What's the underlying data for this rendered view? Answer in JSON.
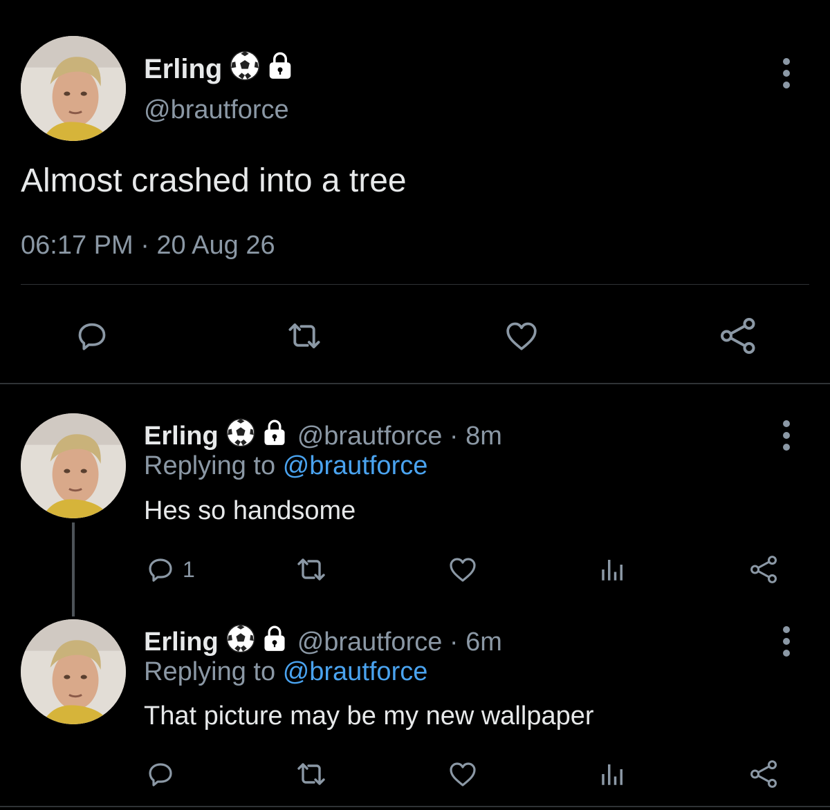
{
  "main_tweet": {
    "author_name": "Erling",
    "name_emoji": "⚽",
    "lock_icon": "lock-icon",
    "handle": "@brautforce",
    "text": "Almost crashed into a tree",
    "timestamp": "06:17 PM · 20 Aug 26",
    "actions": [
      "reply-icon",
      "retweet-icon",
      "like-icon",
      "share-icon"
    ]
  },
  "replies": [
    {
      "author_name": "Erling",
      "handle_time": "@brautforce · 8m",
      "replying_label": "Replying to",
      "replying_handle": "@brautforce",
      "text": "Hes so handsome",
      "reply_count": "1"
    },
    {
      "author_name": "Erling",
      "handle_time": "@brautforce · 6m",
      "replying_label": "Replying to",
      "replying_handle": "@brautforce",
      "text": "That picture may be my new wallpaper",
      "reply_count": ""
    }
  ],
  "colors": {
    "background": "#000000",
    "text": "#e7e9ea",
    "muted": "#8b98a5",
    "link": "#4aa3ef",
    "divider": "#2f3336"
  }
}
